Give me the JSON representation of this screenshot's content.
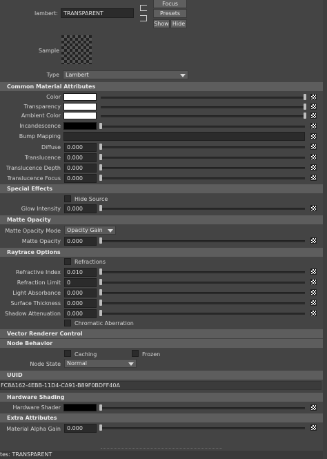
{
  "header": {
    "material_label": "lambert:",
    "material_value": "TRANSPARENT",
    "focus_label": "Focus",
    "presets_label": "Presets",
    "show_label": "Show",
    "hide_label": "Hide",
    "sample_label": "Sample",
    "type_label": "Type",
    "type_value": "Lambert"
  },
  "common": {
    "title": "Common Material Attributes",
    "color_label": "Color",
    "transparency_label": "Transparency",
    "ambient_label": "Ambient Color",
    "incandescence_label": "Incandescence",
    "bump_label": "Bump Mapping",
    "diffuse_label": "Diffuse",
    "diffuse_value": "0.000",
    "translucence_label": "Translucence",
    "translucence_value": "0.000",
    "translucence_depth_label": "Translucence Depth",
    "translucence_depth_value": "0.000",
    "translucence_focus_label": "Translucence Focus",
    "translucence_focus_value": "0.000",
    "colors": {
      "color": "#ffffff",
      "transparency": "#ffffff",
      "ambient": "#ffffff",
      "incandescence": "#000000"
    }
  },
  "special": {
    "title": "Special Effects",
    "hide_source_label": "Hide Source",
    "glow_label": "Glow Intensity",
    "glow_value": "0.000"
  },
  "matte": {
    "title": "Matte Opacity",
    "mode_label": "Matte Opacity Mode",
    "mode_value": "Opacity Gain",
    "opacity_label": "Matte Opacity",
    "opacity_value": "0.000"
  },
  "raytrace": {
    "title": "Raytrace Options",
    "refractions_label": "Refractions",
    "refractive_index_label": "Refractive Index",
    "refractive_index_value": "0.010",
    "refraction_limit_label": "Refraction Limit",
    "refraction_limit_value": "0",
    "light_absorbance_label": "Light Absorbance",
    "light_absorbance_value": "0.000",
    "surface_thickness_label": "Surface Thickness",
    "surface_thickness_value": "0.000",
    "shadow_attenuation_label": "Shadow Attenuation",
    "shadow_attenuation_value": "0.000",
    "chromatic_label": "Chromatic Aberration"
  },
  "vector": {
    "title": "Vector Renderer Control"
  },
  "node": {
    "title": "Node Behavior",
    "caching_label": "Caching",
    "frozen_label": "Frozen",
    "state_label": "Node State",
    "state_value": "Normal"
  },
  "uuid": {
    "title": "UUID",
    "value": "FC8A162-4EBB-11D4-CA91-B89F0BDFF40A"
  },
  "hardware": {
    "title": "Hardware Shading",
    "shader_label": "Hardware Shader",
    "shader_color": "#000000"
  },
  "extra": {
    "title": "Extra Attributes",
    "alpha_gain_label": "Material Alpha Gain",
    "alpha_gain_value": "0.000"
  },
  "footer": {
    "notes_label": "tes:  TRANSPARENT"
  }
}
